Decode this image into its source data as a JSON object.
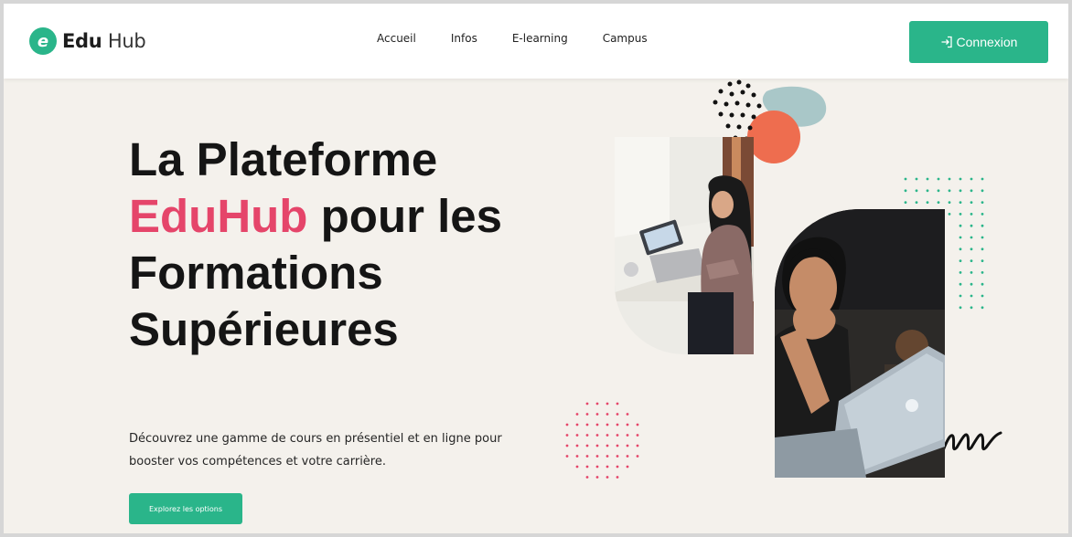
{
  "brand": {
    "mark": "e",
    "name_bold": "Edu",
    "name_light": "Hub"
  },
  "nav": {
    "items": [
      "Accueil",
      "Infos",
      "E-learning",
      "Campus"
    ]
  },
  "header": {
    "login_label": "Connexion",
    "login_icon": "login-arrow-icon"
  },
  "hero": {
    "title_line1": "La Plateforme",
    "title_accent": "EduHub",
    "title_line2_rest": " pour les",
    "title_line3": "Formations",
    "title_line4": "Supérieures",
    "subtitle": "Découvrez une gamme de cours en présentiel et en ligne pour booster vos compétences et votre carrière.",
    "cta_label": "Explorez les options"
  },
  "colors": {
    "brand_green": "#2ab58a",
    "accent_pink": "#e5456a",
    "background": "#f4f1ec",
    "blob_coral": "#ee6d4f",
    "blob_blue": "#a9c7c8"
  }
}
